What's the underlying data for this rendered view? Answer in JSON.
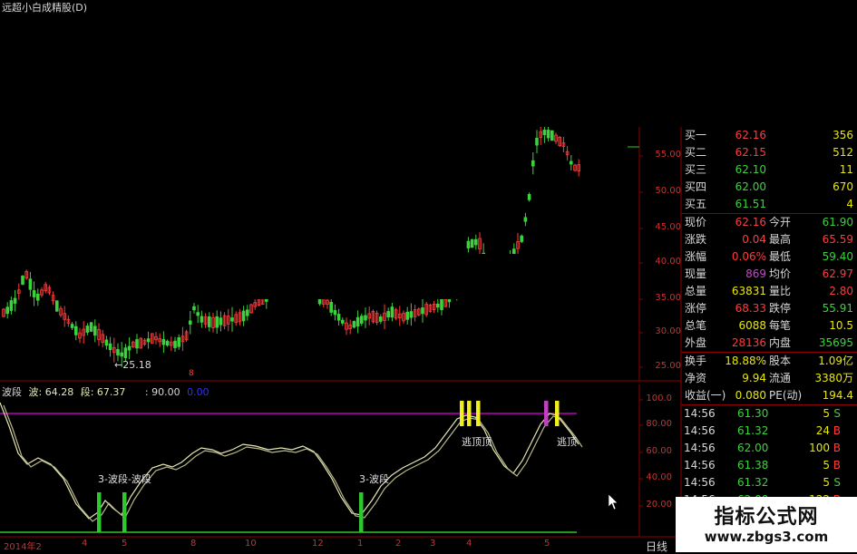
{
  "app_title": "远超小白成精股(D)",
  "annotations": {
    "low_price": "←25.18",
    "low_marker": "8",
    "wave1": "3-波段-波段",
    "wave2": "3-波段",
    "escape1": "逃顶顶",
    "escape2": "逃顶"
  },
  "indicator_legend": {
    "name": "波段",
    "wave": "波: 64.28",
    "segment": "段: 67.37",
    "level": ": 90.00",
    "extra": "0.00"
  },
  "price_axis": [
    "55.00",
    "50.00",
    "45.00",
    "40.00",
    "35.00",
    "30.00",
    "25.00"
  ],
  "osc_axis": [
    "100.0",
    "80.00",
    "60.00",
    "40.00",
    "20.00"
  ],
  "x_axis": [
    "2014年2",
    "4",
    "5",
    "8",
    "10",
    "12",
    "1",
    "2",
    "3",
    "4",
    "5"
  ],
  "period": "日线",
  "quote_panel": {
    "bids": [
      {
        "label": "买一",
        "price": "62.16",
        "vol": "356",
        "color": "#ff3b3b"
      },
      {
        "label": "买二",
        "price": "62.15",
        "vol": "512",
        "color": "#ff3b3b"
      },
      {
        "label": "买三",
        "price": "62.10",
        "vol": "11",
        "color": "#3bd23b"
      },
      {
        "label": "买四",
        "price": "62.00",
        "vol": "670",
        "color": "#3bd23b"
      },
      {
        "label": "买五",
        "price": "61.51",
        "vol": "4",
        "color": "#3bd23b"
      }
    ],
    "stats": [
      {
        "l1": "现价",
        "v1": "62.16",
        "c1": "#ff3b3b",
        "l2": "今开",
        "v2": "61.90",
        "c2": "#3bd23b"
      },
      {
        "l1": "涨跌",
        "v1": "0.04",
        "c1": "#ff3b3b",
        "l2": "最高",
        "v2": "65.59",
        "c2": "#ff3b3b"
      },
      {
        "l1": "涨幅",
        "v1": "0.06%",
        "c1": "#ff3b3b",
        "l2": "最低",
        "v2": "59.40",
        "c2": "#3bd23b"
      },
      {
        "l1": "现量",
        "v1": "869",
        "c1": "#d040d0",
        "l2": "均价",
        "v2": "62.97",
        "c2": "#ff3b3b"
      },
      {
        "l1": "总量",
        "v1": "63831",
        "c1": "#e8e800",
        "l2": "量比",
        "v2": "2.80",
        "c2": "#ff3b3b"
      },
      {
        "l1": "涨停",
        "v1": "68.33",
        "c1": "#ff3b3b",
        "l2": "跌停",
        "v2": "55.91",
        "c2": "#3bd23b"
      },
      {
        "l1": "总笔",
        "v1": "6088",
        "c1": "#e8e800",
        "l2": "每笔",
        "v2": "10.5",
        "c2": "#e8e800"
      },
      {
        "l1": "外盘",
        "v1": "28136",
        "c1": "#ff3b3b",
        "l2": "内盘",
        "v2": "35695",
        "c2": "#3bd23b"
      }
    ],
    "fund": [
      {
        "l1": "换手",
        "v1": "18.88%",
        "l2": "股本",
        "v2": "1.09亿"
      },
      {
        "l1": "净资",
        "v1": "9.94",
        "l2": "流通",
        "v2": "3380万"
      },
      {
        "l1": "收益(一)",
        "v1": "0.080",
        "l2": "PE(动)",
        "v2": "194.4"
      }
    ],
    "ticks": [
      {
        "time": "14:56",
        "price": "61.30",
        "pc": "#3bd23b",
        "qty": "5",
        "side": "S",
        "sc": "#3bd23b"
      },
      {
        "time": "14:56",
        "price": "61.32",
        "pc": "#3bd23b",
        "qty": "24",
        "side": "B",
        "sc": "#ff3b3b"
      },
      {
        "time": "14:56",
        "price": "62.00",
        "pc": "#3bd23b",
        "qty": "100",
        "side": "B",
        "sc": "#ff3b3b"
      },
      {
        "time": "14:56",
        "price": "61.38",
        "pc": "#3bd23b",
        "qty": "5",
        "side": "B",
        "sc": "#ff3b3b"
      },
      {
        "time": "14:56",
        "price": "61.32",
        "pc": "#3bd23b",
        "qty": "5",
        "side": "S",
        "sc": "#3bd23b"
      },
      {
        "time": "14:56",
        "price": "62.00",
        "pc": "#3bd23b",
        "qty": "122",
        "side": "B",
        "sc": "#ff3b3b"
      }
    ]
  },
  "watermark": {
    "line1": "指标公式网",
    "line2": "www.zbgs3.com"
  },
  "colors": {
    "up": "#ff3b3b",
    "down": "#3bd23b",
    "wave": "#e6e6b4",
    "level": "#c000c0",
    "frame": "#8b0000"
  }
}
